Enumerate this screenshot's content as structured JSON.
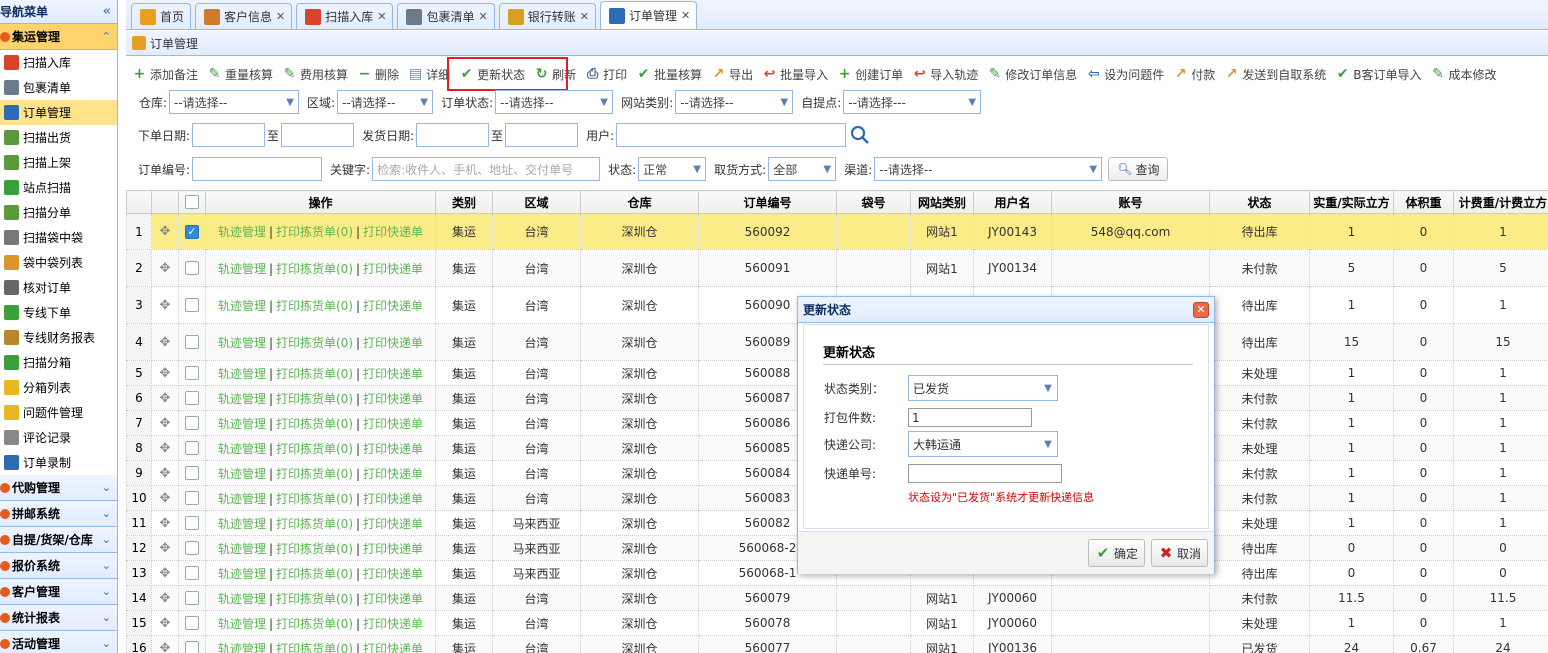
{
  "sidebar": {
    "title": "导航菜单",
    "collapse_icon": "«",
    "active_group": "集运管理",
    "items": [
      {
        "label": "扫描入库",
        "icon": "scan-in-icon",
        "color": "#d9432b"
      },
      {
        "label": "包裹清单",
        "icon": "truck-icon",
        "color": "#6a7a8a"
      },
      {
        "label": "订单管理",
        "icon": "order-icon",
        "color": "#2d6bb5",
        "active": true
      },
      {
        "label": "扫描出货",
        "icon": "scan-out-icon",
        "color": "#5a9a3a"
      },
      {
        "label": "扫描上架",
        "icon": "shelf-icon",
        "color": "#5a9a3a"
      },
      {
        "label": "站点扫描",
        "icon": "check-icon",
        "color": "#3aa03a"
      },
      {
        "label": "扫描分单",
        "icon": "split-icon",
        "color": "#5a9a3a"
      },
      {
        "label": "扫描袋中袋",
        "icon": "printer-icon",
        "color": "#777"
      },
      {
        "label": "袋中袋列表",
        "icon": "box-icon",
        "color": "#d9962b"
      },
      {
        "label": "核对订单",
        "icon": "magnifier-icon",
        "color": "#666"
      },
      {
        "label": "专线下单",
        "icon": "check-icon",
        "color": "#3aa03a"
      },
      {
        "label": "专线财务报表",
        "icon": "ruler-icon",
        "color": "#b8862b"
      },
      {
        "label": "扫描分箱",
        "icon": "check-icon",
        "color": "#3aa03a"
      },
      {
        "label": "分箱列表",
        "icon": "lightning-icon",
        "color": "#e8b820"
      },
      {
        "label": "问题件管理",
        "icon": "warning-icon",
        "color": "#e8b820"
      },
      {
        "label": "评论记录",
        "icon": "document-icon",
        "color": "#888"
      },
      {
        "label": "订单录制",
        "icon": "monitor-icon",
        "color": "#2d6bb5"
      }
    ],
    "groups": [
      {
        "label": "代购管理"
      },
      {
        "label": "拼邮系统"
      },
      {
        "label": "自提/货架/仓库"
      },
      {
        "label": "报价系统"
      },
      {
        "label": "客户管理"
      },
      {
        "label": "统计报表"
      },
      {
        "label": "活动管理"
      }
    ]
  },
  "tabs": [
    {
      "label": "首页",
      "icon": "home-icon",
      "color": "#e8a020",
      "closable": false
    },
    {
      "label": "客户信息",
      "icon": "user-icon",
      "color": "#d07a30",
      "closable": true
    },
    {
      "label": "扫描入库",
      "icon": "scan-in-icon",
      "color": "#d9432b",
      "closable": true
    },
    {
      "label": "包裹清单",
      "icon": "truck-icon",
      "color": "#6a7a8a",
      "closable": true
    },
    {
      "label": "银行转账",
      "icon": "lock-icon",
      "color": "#d8a020",
      "closable": true
    },
    {
      "label": "订单管理",
      "icon": "order-icon",
      "color": "#2d6bb5",
      "closable": true,
      "active": true
    }
  ],
  "panel": {
    "title": "订单管理"
  },
  "toolbar": [
    {
      "label": "添加备注",
      "icon": "add-icon",
      "glyph": "+",
      "color": "#3aa03a"
    },
    {
      "label": "重量核算",
      "icon": "pencil-icon",
      "glyph": "✎",
      "color": "#3aa03a"
    },
    {
      "label": "费用核算",
      "icon": "pencil-icon",
      "glyph": "✎",
      "color": "#3aa03a"
    },
    {
      "label": "删除",
      "icon": "remove-icon",
      "glyph": "−",
      "color": "#3aa03a"
    },
    {
      "label": "详细",
      "icon": "document-icon",
      "glyph": "▤",
      "color": "#6a8ab8"
    },
    {
      "label": "更新状态",
      "icon": "check-icon",
      "glyph": "✔",
      "color": "#3aa03a"
    },
    {
      "label": "刷新",
      "icon": "refresh-icon",
      "glyph": "↻",
      "color": "#3aa03a"
    },
    {
      "label": "打印",
      "icon": "printer-icon",
      "glyph": "⎙",
      "color": "#4a6a9a"
    },
    {
      "label": "批量核算",
      "icon": "check-icon",
      "glyph": "✔",
      "color": "#3aa03a"
    },
    {
      "label": "导出",
      "icon": "export-icon",
      "glyph": "↗",
      "color": "#d8962b"
    },
    {
      "label": "批量导入",
      "icon": "import-icon",
      "glyph": "↩",
      "color": "#d9432b"
    },
    {
      "label": "创建订单",
      "icon": "add-icon",
      "glyph": "+",
      "color": "#3aa03a"
    },
    {
      "label": "导入轨迹",
      "icon": "import-icon",
      "glyph": "↩",
      "color": "#d9432b"
    },
    {
      "label": "修改订单信息",
      "icon": "pencil-icon",
      "glyph": "✎",
      "color": "#3aa03a"
    },
    {
      "label": "设为问题件",
      "icon": "back-icon",
      "glyph": "⇦",
      "color": "#2d6bb5"
    },
    {
      "label": "付款",
      "icon": "export-icon",
      "glyph": "↗",
      "color": "#d8962b"
    },
    {
      "label": "发送到自取系统",
      "icon": "export-icon",
      "glyph": "↗",
      "color": "#d8962b"
    },
    {
      "label": "B客订单导入",
      "icon": "check-icon",
      "glyph": "✔",
      "color": "#3aa03a"
    },
    {
      "label": "成本修改",
      "icon": "pencil-icon",
      "glyph": "✎",
      "color": "#3aa03a"
    }
  ],
  "filters": {
    "warehouse_label": "仓库:",
    "warehouse_value": "--请选择--",
    "region_label": "区域:",
    "region_value": "--请选择--",
    "order_status_label": "订单状态:",
    "order_status_value": "--请选择--",
    "site_type_label": "网站类别:",
    "site_type_value": "--请选择--",
    "pickup_label": "自提点:",
    "pickup_value": "--请选择---",
    "order_date_label": "下单日期:",
    "to1": "至",
    "ship_date_label": "发货日期:",
    "to2": "至",
    "user_label": "用户:",
    "order_no_label": "订单编号:",
    "keyword_label": "关键字:",
    "keyword_placeholder": "检索:收件人、手机、地址、交付单号",
    "status_label": "状态:",
    "status_value": "正常",
    "ship_method_label": "取货方式:",
    "ship_method_value": "全部",
    "channel_label": "渠道:",
    "channel_value": "--请选择--",
    "query_label": "查询"
  },
  "grid": {
    "columns": [
      "操作",
      "类别",
      "区域",
      "仓库",
      "订单编号",
      "袋号",
      "网站类别",
      "用户名",
      "账号",
      "状态",
      "实重/实际立方",
      "体积重",
      "计费重/计费立方"
    ],
    "op_links": [
      "轨迹管理",
      "打印拣货单(0)",
      "打印快递单"
    ],
    "rows": [
      {
        "n": "1",
        "cat": "集运",
        "region": "台湾",
        "wh": "深圳仓",
        "order": "560092",
        "bag": "",
        "site": "网站1",
        "user": "JY00143",
        "acct": "548@qq.com",
        "status": "待出库",
        "w": "1",
        "vol": "0",
        "bill": "1",
        "checked": true
      },
      {
        "n": "2",
        "cat": "集运",
        "region": "台湾",
        "wh": "深圳仓",
        "order": "560091",
        "bag": "",
        "site": "网站1",
        "user": "JY00134",
        "acct": "",
        "status": "未付款",
        "w": "5",
        "vol": "0",
        "bill": "5"
      },
      {
        "n": "3",
        "cat": "集运",
        "region": "台湾",
        "wh": "深圳仓",
        "order": "560090",
        "bag": "",
        "site": "",
        "user": "",
        "acct": "",
        "status": "待出库",
        "w": "1",
        "vol": "0",
        "bill": "1"
      },
      {
        "n": "4",
        "cat": "集运",
        "region": "台湾",
        "wh": "深圳仓",
        "order": "560089",
        "bag": "",
        "site": "",
        "user": "",
        "acct": "",
        "status": "待出库",
        "w": "15",
        "vol": "0",
        "bill": "15"
      },
      {
        "n": "5",
        "cat": "集运",
        "region": "台湾",
        "wh": "深圳仓",
        "order": "560088",
        "bag": "",
        "site": "",
        "user": "",
        "acct": "",
        "status": "未处理",
        "w": "1",
        "vol": "0",
        "bill": "1"
      },
      {
        "n": "6",
        "cat": "集运",
        "region": "台湾",
        "wh": "深圳仓",
        "order": "560087",
        "bag": "",
        "site": "",
        "user": "",
        "acct": "",
        "status": "未付款",
        "w": "1",
        "vol": "0",
        "bill": "1"
      },
      {
        "n": "7",
        "cat": "集运",
        "region": "台湾",
        "wh": "深圳仓",
        "order": "560086",
        "bag": "",
        "site": "",
        "user": "",
        "acct": "",
        "status": "未付款",
        "w": "1",
        "vol": "0",
        "bill": "1"
      },
      {
        "n": "8",
        "cat": "集运",
        "region": "台湾",
        "wh": "深圳仓",
        "order": "560085",
        "bag": "",
        "site": "",
        "user": "",
        "acct": "",
        "status": "未处理",
        "w": "1",
        "vol": "0",
        "bill": "1"
      },
      {
        "n": "9",
        "cat": "集运",
        "region": "台湾",
        "wh": "深圳仓",
        "order": "560084",
        "bag": "",
        "site": "",
        "user": "",
        "acct": "",
        "status": "未付款",
        "w": "1",
        "vol": "0",
        "bill": "1"
      },
      {
        "n": "10",
        "cat": "集运",
        "region": "台湾",
        "wh": "深圳仓",
        "order": "560083",
        "bag": "",
        "site": "",
        "user": "",
        "acct": "",
        "status": "未付款",
        "w": "1",
        "vol": "0",
        "bill": "1"
      },
      {
        "n": "11",
        "cat": "集运",
        "region": "马来西亚",
        "wh": "深圳仓",
        "order": "560082",
        "bag": "",
        "site": "",
        "user": "",
        "acct": "",
        "status": "未处理",
        "w": "1",
        "vol": "0",
        "bill": "1"
      },
      {
        "n": "12",
        "cat": "集运",
        "region": "马来西亚",
        "wh": "深圳仓",
        "order": "560068-2",
        "bag": "",
        "site": "",
        "user": "",
        "acct": "",
        "status": "待出库",
        "w": "0",
        "vol": "0",
        "bill": "0"
      },
      {
        "n": "13",
        "cat": "集运",
        "region": "马来西亚",
        "wh": "深圳仓",
        "order": "560068-1",
        "bag": "",
        "site": "",
        "user": "",
        "acct": "",
        "status": "待出库",
        "w": "0",
        "vol": "0",
        "bill": "0"
      },
      {
        "n": "14",
        "cat": "集运",
        "region": "台湾",
        "wh": "深圳仓",
        "order": "560079",
        "bag": "",
        "site": "网站1",
        "user": "JY00060",
        "acct": "",
        "status": "未付款",
        "w": "11.5",
        "vol": "0",
        "bill": "11.5"
      },
      {
        "n": "15",
        "cat": "集运",
        "region": "台湾",
        "wh": "深圳仓",
        "order": "560078",
        "bag": "",
        "site": "网站1",
        "user": "JY00060",
        "acct": "",
        "status": "未处理",
        "w": "1",
        "vol": "0",
        "bill": "1"
      },
      {
        "n": "16",
        "cat": "集运",
        "region": "台湾",
        "wh": "深圳仓",
        "order": "560077",
        "bag": "",
        "site": "网站1",
        "user": "JY00136",
        "acct": "",
        "status": "已发货",
        "w": "24",
        "vol": "0.67",
        "bill": "24"
      }
    ]
  },
  "dialog": {
    "title": "更新状态",
    "heading": "更新状态",
    "status_type_label": "状态类别：",
    "status_type_value": "已发货",
    "package_count_label": "打包件数:",
    "package_count_value": "1",
    "courier_label": "快递公司:",
    "courier_value": "大韩运通",
    "tracking_label": "快递单号:",
    "tracking_value": "",
    "hint": "状态设为\"已发货\"系统才更新快递信息",
    "ok_label": "确定",
    "cancel_label": "取消"
  }
}
